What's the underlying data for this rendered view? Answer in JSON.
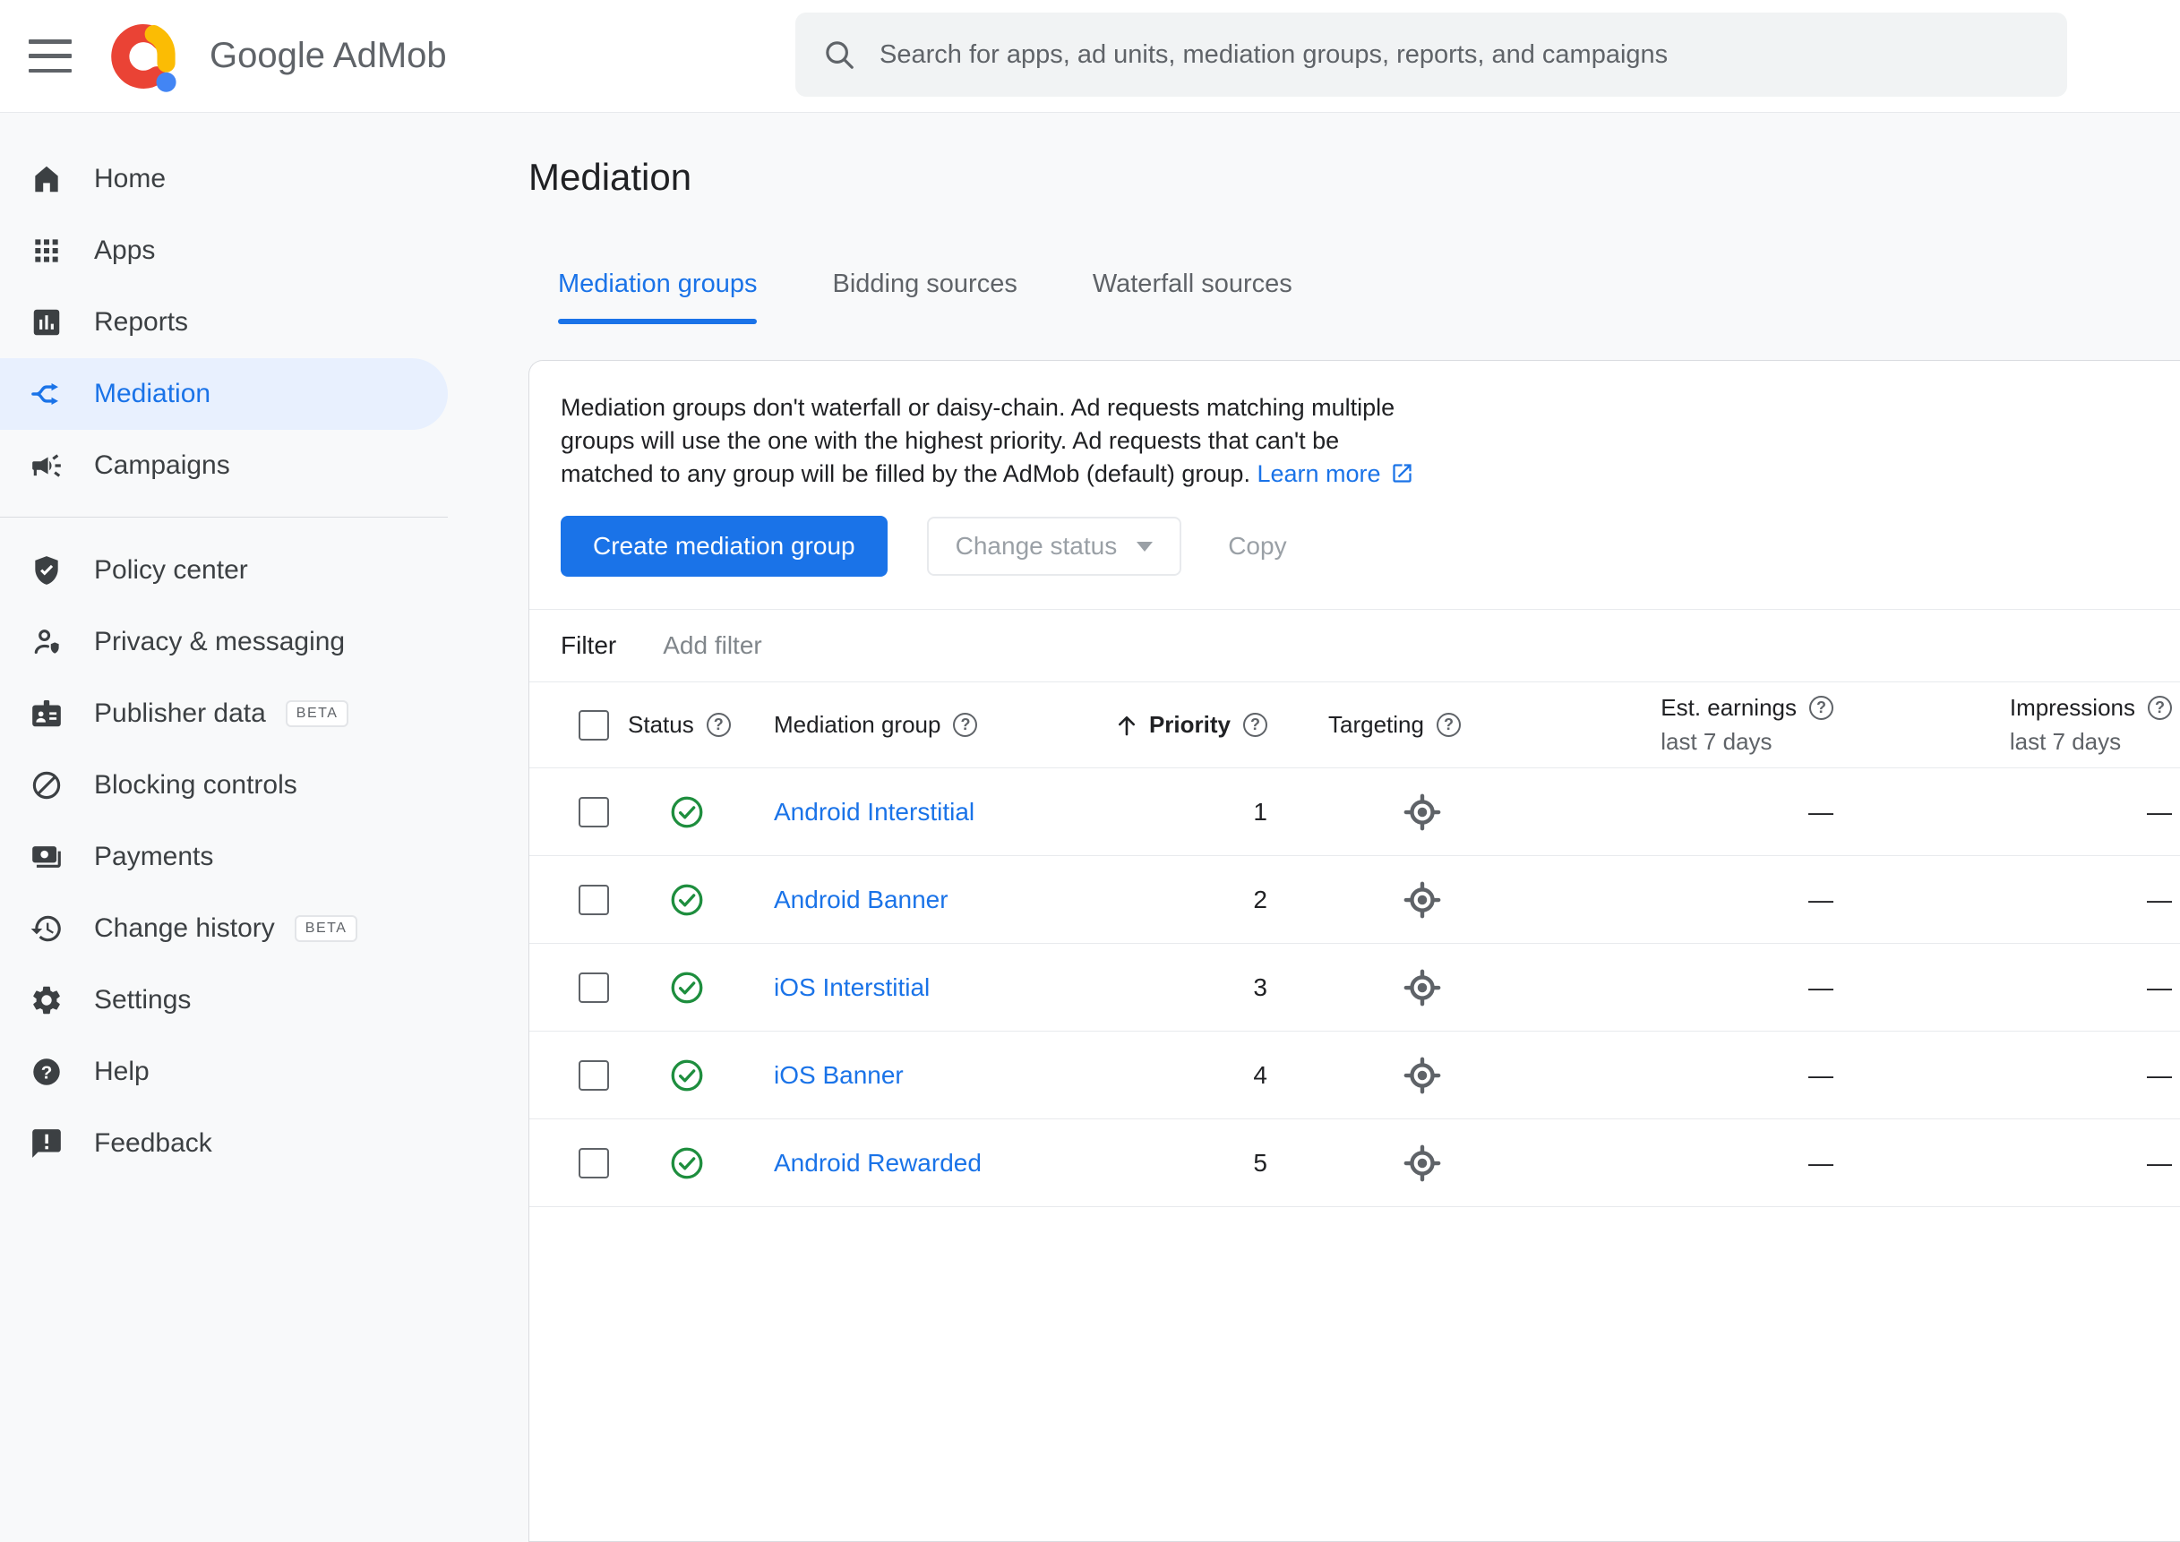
{
  "header": {
    "brand": "Google AdMob",
    "search_placeholder": "Search for apps, ad units, mediation groups, reports, and campaigns"
  },
  "glyphs": {
    "question": "?"
  },
  "colors": {
    "accent_blue": "#1a73e8",
    "active_item_bg": "#e8f0fe",
    "status_green": "#1e8e3e",
    "logo_red": "#ea4335",
    "logo_yellow": "#fbbc04",
    "logo_blue": "#4285f4"
  },
  "sidebar": {
    "main_items": [
      {
        "label": "Home"
      },
      {
        "label": "Apps"
      },
      {
        "label": "Reports"
      },
      {
        "label": "Mediation",
        "active": true
      },
      {
        "label": "Campaigns"
      }
    ],
    "secondary_items": [
      {
        "label": "Policy center"
      },
      {
        "label": "Privacy & messaging"
      },
      {
        "label": "Publisher data",
        "badge": "BETA"
      },
      {
        "label": "Blocking controls"
      },
      {
        "label": "Payments"
      },
      {
        "label": "Change history",
        "badge": "BETA"
      },
      {
        "label": "Settings"
      },
      {
        "label": "Help"
      },
      {
        "label": "Feedback"
      }
    ]
  },
  "page": {
    "title": "Mediation",
    "tabs": [
      {
        "label": "Mediation groups",
        "active": true
      },
      {
        "label": "Bidding sources"
      },
      {
        "label": "Waterfall sources"
      }
    ]
  },
  "card": {
    "description": "Mediation groups don't waterfall or daisy-chain. Ad requests matching multiple groups will use the one with the highest priority. Ad requests that can't be matched to any group will be filled by the AdMob (default) group.",
    "learn_more": "Learn more",
    "buttons": {
      "create": "Create mediation group",
      "change_status": "Change status",
      "copy": "Copy"
    },
    "filter": {
      "label": "Filter",
      "add": "Add filter"
    },
    "table": {
      "columns": {
        "status": "Status",
        "mediation_group": "Mediation group",
        "priority": "Priority",
        "targeting": "Targeting",
        "est_earnings": "Est. earnings",
        "impressions": "Impressions",
        "period": "last 7 days"
      },
      "rows": [
        {
          "name": "Android Interstitial",
          "priority": "1",
          "est_earnings": "—",
          "impressions": "—"
        },
        {
          "name": "Android Banner",
          "priority": "2",
          "est_earnings": "—",
          "impressions": "—"
        },
        {
          "name": "iOS Interstitial",
          "priority": "3",
          "est_earnings": "—",
          "impressions": "—"
        },
        {
          "name": "iOS Banner",
          "priority": "4",
          "est_earnings": "—",
          "impressions": "—"
        },
        {
          "name": "Android Rewarded",
          "priority": "5",
          "est_earnings": "—",
          "impressions": "—"
        }
      ]
    }
  }
}
